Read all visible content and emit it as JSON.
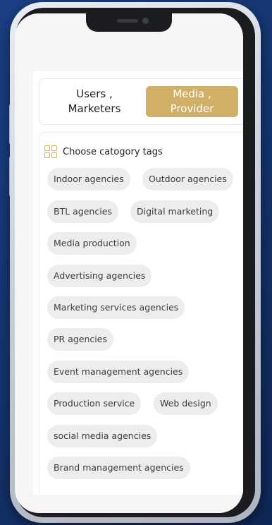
{
  "user_type_toggle": {
    "users_label": "Users ,\nMarketers",
    "media_label": "Media ,\nProvider",
    "selected": "media_label",
    "accent_color": "#d2af67"
  },
  "tags_section": {
    "title": "Choose catogory tags",
    "icon": "grid-icon",
    "tags": [
      "Indoor agencies",
      "Outdoor agencies",
      "BTL agencies",
      "Digital marketing",
      "Media production",
      "Advertising agencies",
      "Marketing services agencies",
      "PR agencies",
      "Event management agencies",
      "Production service",
      "Web design",
      "social media agencies",
      "Brand management agencies"
    ]
  }
}
